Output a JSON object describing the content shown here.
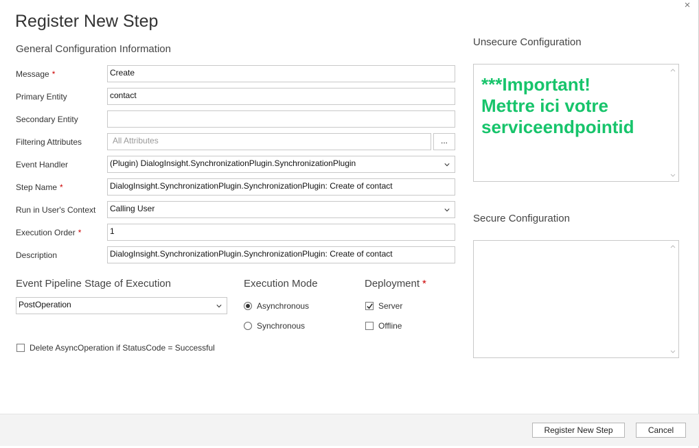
{
  "dialog": {
    "title": "Register New Step",
    "close_glyph": "×",
    "section_title": "General Configuration Information"
  },
  "fields": {
    "message": {
      "label": "Message",
      "value": "Create",
      "required": "*"
    },
    "primary_entity": {
      "label": "Primary Entity",
      "value": "contact"
    },
    "secondary_entity": {
      "label": "Secondary Entity",
      "value": ""
    },
    "filtering_attributes": {
      "label": "Filtering Attributes",
      "placeholder": "All Attributes",
      "button": "..."
    },
    "event_handler": {
      "label": "Event Handler",
      "value": "(Plugin) DialogInsight.SynchronizationPlugin.SynchronizationPlugin"
    },
    "step_name": {
      "label": "Step Name",
      "value": "DialogInsight.SynchronizationPlugin.SynchronizationPlugin: Create of contact",
      "required": "*"
    },
    "run_context": {
      "label": "Run in User's Context",
      "value": "Calling User"
    },
    "execution_order": {
      "label": "Execution Order",
      "value": "1",
      "required": "*"
    },
    "description": {
      "label": "Description",
      "value": "DialogInsight.SynchronizationPlugin.SynchronizationPlugin: Create of contact"
    }
  },
  "pipeline": {
    "title": "Event Pipeline Stage of Execution",
    "value": "PostOperation"
  },
  "execution_mode": {
    "title": "Execution Mode",
    "options": [
      "Asynchronous",
      "Synchronous"
    ],
    "selected": "Asynchronous"
  },
  "deployment": {
    "title": "Deployment",
    "required": "*",
    "server": {
      "label": "Server",
      "checked": true
    },
    "offline": {
      "label": "Offline",
      "checked": false
    }
  },
  "delete_async": {
    "label": "Delete AsyncOperation if StatusCode = Successful",
    "checked": false
  },
  "unsecure_config": {
    "label": "Unsecure  Configuration",
    "text": "***Important!\nMettre ici votre\nserviceendpointid"
  },
  "secure_config": {
    "label": "Secure  Configuration",
    "text": ""
  },
  "footer": {
    "register_button": "Register New Step",
    "cancel_button": "Cancel"
  },
  "colors": {
    "accent_green": "#17c46b",
    "required_red": "#cc0000"
  },
  "icons": {
    "close": "close-icon",
    "dropdown": "chevron-down-icon",
    "check": "checkmark-icon"
  }
}
